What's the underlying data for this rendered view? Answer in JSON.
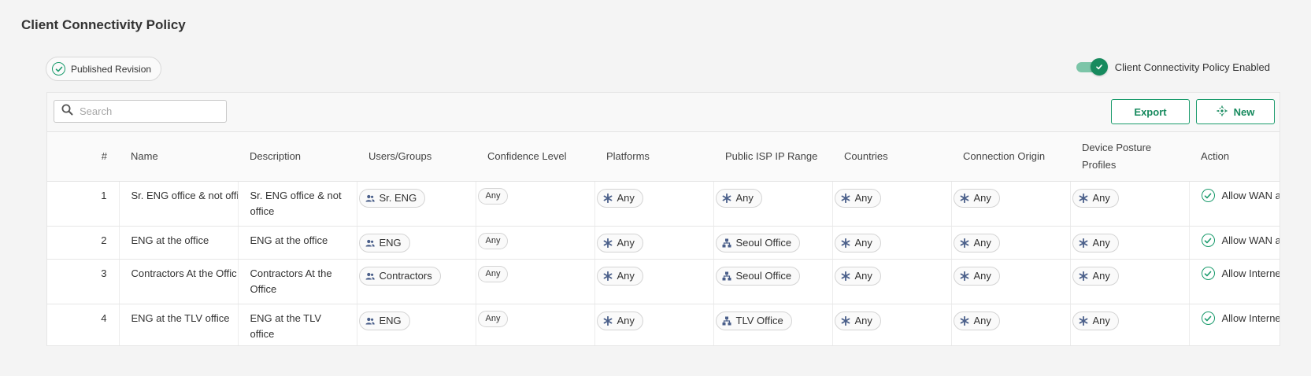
{
  "page": {
    "title": "Client Connectivity Policy"
  },
  "revision": {
    "label": "Published Revision"
  },
  "policy_toggle": {
    "label": "Client Connectivity Policy Enabled",
    "enabled": true
  },
  "search": {
    "placeholder": "Search"
  },
  "toolbar": {
    "export_label": "Export",
    "new_label": "New"
  },
  "colors": {
    "accent": "#178a5e",
    "icon": "#4a5f8a"
  },
  "table": {
    "headers": [
      "#",
      "Name",
      "Description",
      "Users/Groups",
      "Confidence Level",
      "Platforms",
      "Public ISP IP Range",
      "Countries",
      "Connection Origin",
      "Device Posture Profiles",
      "Action"
    ],
    "rows": [
      {
        "num": "1",
        "name": "Sr. ENG office & not offi",
        "description": "Sr. ENG office & not office",
        "users": "Sr. ENG",
        "confidence": "Any",
        "platforms": "Any",
        "isp": "Any",
        "countries": "Any",
        "origin": "Any",
        "posture": "Any",
        "action": "Allow WAN a"
      },
      {
        "num": "2",
        "name": "ENG at the office",
        "description": "ENG at the office",
        "users": "ENG",
        "confidence": "Any",
        "platforms": "Any",
        "isp": "Seoul Office",
        "countries": "Any",
        "origin": "Any",
        "posture": "Any",
        "action": "Allow WAN a"
      },
      {
        "num": "3",
        "name": "Contractors At the Offic",
        "description": "Contractors At the Office",
        "users": "Contractors",
        "confidence": "Any",
        "platforms": "Any",
        "isp": "Seoul Office",
        "countries": "Any",
        "origin": "Any",
        "posture": "Any",
        "action": "Allow Interne"
      },
      {
        "num": "4",
        "name": "ENG at the TLV office",
        "description": "ENG at the TLV office",
        "users": "ENG",
        "confidence": "Any",
        "platforms": "Any",
        "isp": "TLV Office",
        "countries": "Any",
        "origin": "Any",
        "posture": "Any",
        "action": "Allow Interne"
      }
    ],
    "icons": {
      "users": "users-icon",
      "any": "asterisk-icon",
      "isp_site": "network-site-icon",
      "action": "check-circle-icon"
    }
  }
}
